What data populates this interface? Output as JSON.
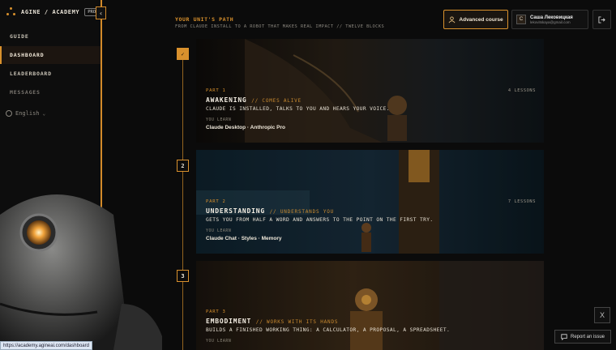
{
  "brand": {
    "name": "AGINE / ACADEMY",
    "badge": "PRO",
    "collapse_glyph": "‹"
  },
  "nav": {
    "items": [
      {
        "label": "GUIDE"
      },
      {
        "label": "DASHBOARD"
      },
      {
        "label": "LEADERBOARD"
      },
      {
        "label": "MESSAGES"
      }
    ],
    "active_index": 1
  },
  "language": {
    "label": "English",
    "chevron": "⌄"
  },
  "header": {
    "title": "YOUR UNIT'S PATH",
    "subtitle": "FROM CLAUDE INSTALL TO A ROBOT THAT MAKES REAL IMPACT // TWELVE BLOCKS",
    "advanced_button": "Advanced course"
  },
  "user": {
    "initial": "С",
    "name": "Саша Лековицкая",
    "email": "lekovitskaya@gmail.com"
  },
  "blocks": [
    {
      "marker": "✓",
      "part": "PART 1",
      "title": "AWAKENING",
      "tag": "// COMES ALIVE",
      "description": "CLAUDE IS INSTALLED, TALKS TO YOU AND HEARS YOUR VOICE.",
      "learn_label": "YOU LEARN",
      "learn_items": "Claude Desktop · Anthropic Pro",
      "lessons": "4 LESSONS"
    },
    {
      "marker": "2",
      "part": "PART 2",
      "title": "UNDERSTANDING",
      "tag": "// UNDERSTANDS YOU",
      "description": "GETS YOU FROM HALF A WORD AND ANSWERS TO THE POINT ON THE FIRST TRY.",
      "learn_label": "YOU LEARN",
      "learn_items": "Claude Chat · Styles · Memory",
      "lessons": "7 LESSONS"
    },
    {
      "marker": "3",
      "part": "PART 3",
      "title": "EMBODIMENT",
      "tag": "// WORKS WITH ITS HANDS",
      "description": "BUILDS A FINISHED WORKING THING: A CALCULATOR, A PROPOSAL, A SPREADSHEET.",
      "learn_label": "YOU LEARN",
      "learn_items": "",
      "lessons": ""
    }
  ],
  "footer": {
    "x_label": "X",
    "report_label": "Report an issue",
    "status_url": "https://academy.agineai.com/dashboard"
  },
  "colors": {
    "accent": "#d9912d",
    "background": "#0b0b0b"
  },
  "icons": [
    "brand-logo-icon",
    "user-icon",
    "logout-icon",
    "globe-icon",
    "chevron-down-icon",
    "chat-bubble-icon",
    "x-logo-icon",
    "check-icon"
  ]
}
